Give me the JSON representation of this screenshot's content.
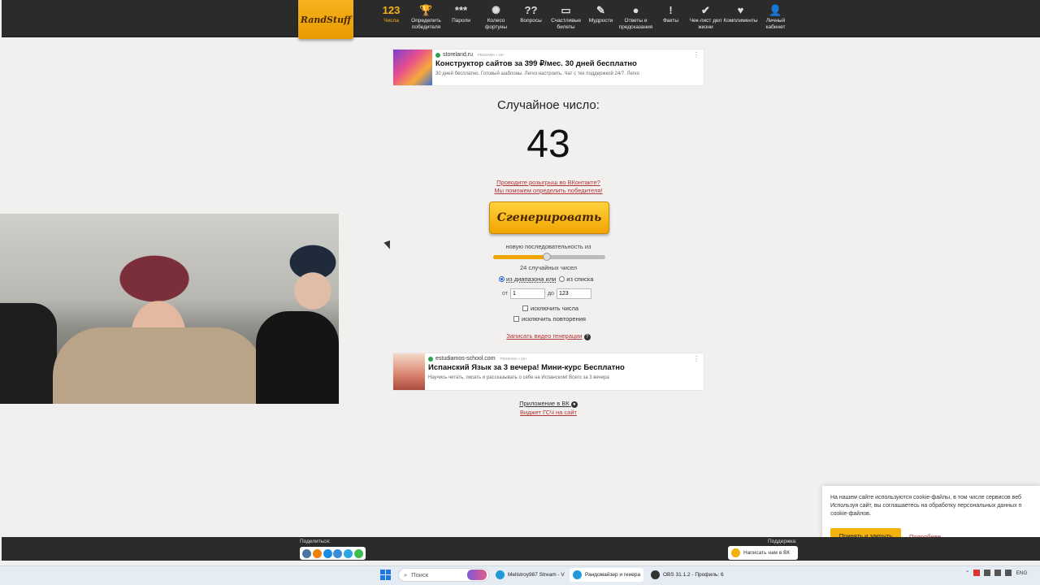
{
  "logo": {
    "text": "RandStuff"
  },
  "nav": [
    {
      "icon": "123",
      "label": "Числа",
      "name": "numbers"
    },
    {
      "icon": "🏆",
      "label": "Определить победителя",
      "name": "winner"
    },
    {
      "icon": "***",
      "label": "Пароли",
      "name": "passwords"
    },
    {
      "icon": "✺",
      "label": "Колесо фортуны",
      "name": "wheel"
    },
    {
      "icon": "??",
      "label": "Вопросы",
      "name": "questions"
    },
    {
      "icon": "▭",
      "label": "Счастливые билеты",
      "name": "tickets"
    },
    {
      "icon": "✎",
      "label": "Мудрости",
      "name": "wisdom"
    },
    {
      "icon": "●",
      "label": "Ответы и предсказания",
      "name": "answers"
    },
    {
      "icon": "!",
      "label": "Факты",
      "name": "facts"
    },
    {
      "icon": "✔",
      "label": "Чек-лист дел жизни",
      "name": "checklist"
    },
    {
      "icon": "♥",
      "label": "Комплименты",
      "name": "compliments"
    },
    {
      "icon": "👤",
      "label": "Личный кабинет",
      "name": "account"
    }
  ],
  "ad1": {
    "domain": "storeland.ru",
    "tag": "РЕКЛАМА • 16+",
    "title": "Конструктор сайтов за 399 ₽/мес. 30 дней бесплатно",
    "desc": "30 дней бесплатно. Готовый шаблоны. Легко настроить. Чат с тех поддержкой 24/7. Легко"
  },
  "generator": {
    "title": "Случайное число:",
    "number": "43",
    "promo1": "Проводите розыгрыш во ВКонтакте?",
    "promo2": "Мы поможем определить победителя!",
    "button": "Сгенерировать",
    "seq_label": "новую последовательность из",
    "slider_value": 24,
    "slider_max": 50,
    "count_label": "24 случайных чисел",
    "radio_range": "из диапазона или",
    "radio_list": "из списка",
    "from_label": "от",
    "from_value": "1",
    "to_label": "до",
    "to_value": "123",
    "exclude_numbers": "исключить числа",
    "exclude_repeats": "исключить повторения",
    "record": "Записать видео генерации"
  },
  "ad2": {
    "domain": "estudiamos-school.com",
    "tag": "РЕКЛАМА • 18+",
    "title": "Испанский Язык за 3 вечера! Мини-курс Бесплатно",
    "desc": "Научись читать, писать и рассказывать о себе на Испанском! Всего за 3 вечера"
  },
  "links": {
    "app": "Приложение в ВК",
    "widget": "Виджет ГСЧ на сайт"
  },
  "cookie": {
    "line1": "На нашем сайте используются cookie-файлы, в том числе сервисов веб",
    "line2": "Используя сайт, вы соглашаетесь на обработку персональных данных п",
    "line3": "cookie-файлов.",
    "accept": "Принять и закрыть",
    "more": "Подробнее"
  },
  "footer": {
    "share": "Поделиться:",
    "support": "Поддержка:",
    "support_btn": "Написать нам в ВК"
  },
  "taskbar": {
    "search": "Поиск",
    "apps": [
      {
        "label": "Mellstroy987 Stream - V",
        "color": "#1e9bd7"
      },
      {
        "label": "Рандомайзер и генера",
        "color": "#1e9bd7"
      },
      {
        "label": "OBS 31.1.2 - Профиль: 6",
        "color": "#333333"
      }
    ],
    "lang": "ENG"
  },
  "colors": {
    "accent": "#f2a500",
    "link": "#b03636",
    "nav_bg": "#2b2b2b"
  }
}
